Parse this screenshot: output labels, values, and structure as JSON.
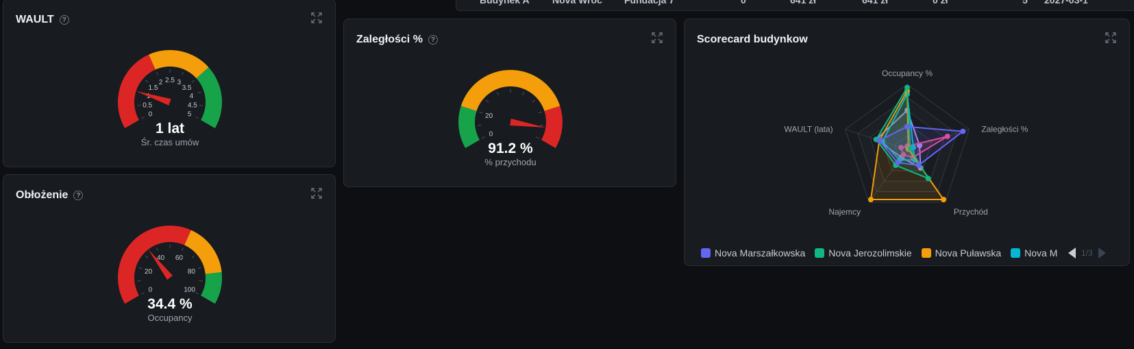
{
  "table_strip": {
    "cells": [
      "Budynek A",
      "Nova Wroc",
      "Fundacja 7",
      "0",
      "641 zł",
      "641 zł",
      "0 zł",
      "5",
      "2027-03-1"
    ]
  },
  "wault": {
    "title": "WAULT",
    "value": 1,
    "value_text": "1 lat",
    "subtitle": "Śr. czas umów",
    "min": 0,
    "max": 5,
    "ticks": [
      "0",
      "0.5",
      "1",
      "1.5",
      "2",
      "2.5",
      "3",
      "3.5",
      "4",
      "4.5",
      "5"
    ],
    "bands": [
      {
        "from": 0,
        "to": 2,
        "color": "#dc2626"
      },
      {
        "from": 2,
        "to": 3.5,
        "color": "#f59e0b"
      },
      {
        "from": 3.5,
        "to": 5,
        "color": "#16a34a"
      }
    ]
  },
  "zaleglosci": {
    "title": "Zaległości %",
    "value": 91.2,
    "value_text": "91.2 %",
    "subtitle": "% przychodu",
    "min": 0,
    "max": 100,
    "ticks": [
      "0",
      "20"
    ],
    "bands": [
      {
        "from": 0,
        "to": 20,
        "color": "#16a34a"
      },
      {
        "from": 20,
        "to": 80,
        "color": "#f59e0b"
      },
      {
        "from": 80,
        "to": 100,
        "color": "#dc2626"
      }
    ]
  },
  "oblozenie": {
    "title": "Obłożenie",
    "value": 34.4,
    "value_text": "34.4 %",
    "subtitle": "Occupancy",
    "min": 0,
    "max": 100,
    "ticks": [
      "0",
      "20",
      "40",
      "60",
      "80",
      "100"
    ],
    "bands": [
      {
        "from": 0,
        "to": 60,
        "color": "#dc2626"
      },
      {
        "from": 60,
        "to": 85,
        "color": "#f59e0b"
      },
      {
        "from": 85,
        "to": 100,
        "color": "#16a34a"
      }
    ]
  },
  "scorecard": {
    "title": "Scorecard budynkow",
    "axes": [
      "Occupancy %",
      "Zaległości %",
      "Przychód",
      "Najemcy",
      "WAULT (lata)"
    ],
    "series": [
      {
        "name": "Nova Marszałkowska",
        "color": "#6366f1",
        "values": [
          0.35,
          0.9,
          0.3,
          0.25,
          0.45
        ]
      },
      {
        "name": "Nova Jerozolimskie",
        "color": "#10b981",
        "values": [
          0.95,
          0.05,
          0.55,
          0.3,
          0.5
        ]
      },
      {
        "name": "Nova Puławska",
        "color": "#f59e0b",
        "values": [
          0.9,
          0.02,
          0.95,
          0.95,
          0.45
        ]
      },
      {
        "name": "Nova M",
        "color": "#06b6d4",
        "values": [
          0.85,
          0.1,
          0.2,
          0.2,
          0.4
        ]
      },
      {
        "name": "",
        "color": "#ec4899",
        "values": [
          0.05,
          0.65,
          0.15,
          0.1,
          0.1
        ]
      },
      {
        "name": "",
        "color": "#a78bfa",
        "values": [
          0.6,
          0.2,
          0.35,
          0.15,
          0.5
        ]
      }
    ],
    "pager_text": "1/3"
  },
  "colors": {
    "background": "#0d0f12",
    "panel": "#181b1f",
    "red": "#dc2626",
    "amber": "#f59e0b",
    "green": "#16a34a"
  }
}
